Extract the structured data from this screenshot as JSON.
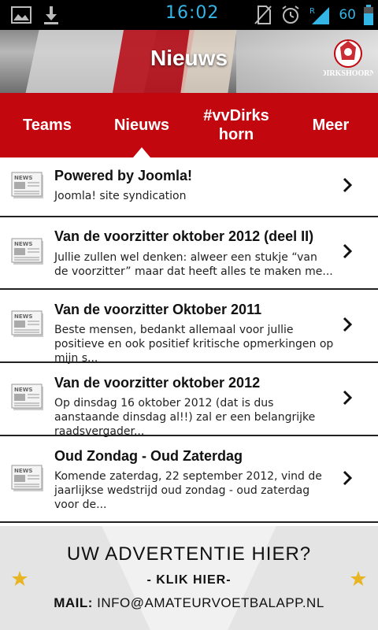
{
  "status_bar": {
    "time": "16:02",
    "battery_percent": "60",
    "icons": [
      "image-icon",
      "download-icon",
      "no-sim-icon",
      "alarm-icon",
      "signal-icon",
      "battery-icon"
    ],
    "signal_label": "R",
    "accent_color": "#33b5e5"
  },
  "header": {
    "title": "Nieuws",
    "logo_text": "DIRKSHOORN"
  },
  "tabs": [
    {
      "label": "Teams",
      "active": false
    },
    {
      "label": "Nieuws",
      "active": true
    },
    {
      "label": "#vvDirks horn",
      "active": false
    },
    {
      "label": "Meer",
      "active": false
    }
  ],
  "theme": {
    "tab_bar_color": "#c2070f"
  },
  "news": [
    {
      "title": "Powered by Joomla!",
      "desc": "Joomla! site syndication",
      "icon": "newspaper-icon"
    },
    {
      "title": "Van de voorzitter oktober 2012 (deel II)",
      "desc": "Jullie zullen wel denken: alweer een stukje “van de voorzitter” maar dat heeft alles te maken me...",
      "icon": "newspaper-icon"
    },
    {
      "title": "Van de voorzitter Oktober 2011",
      "desc": "Beste mensen, bedankt allemaal voor jullie positieve en ook positief kritische opmerkingen op mijn s...",
      "icon": "newspaper-icon"
    },
    {
      "title": "Van de voorzitter oktober 2012",
      "desc": "Op dinsdag 16 oktober 2012 (dat is dus aanstaande dinsdag al!!) zal er een belangrijke raadsvergader...",
      "icon": "newspaper-icon"
    },
    {
      "title": "Oud Zondag - Oud Zaterdag",
      "desc": "Komende zaterdag, 22 september 2012, vind de jaarlijkse wedstrijd oud zondag - oud zaterdag voor de...",
      "icon": "newspaper-icon"
    }
  ],
  "ad": {
    "headline": "UW ADVERTENTIE HIER?",
    "click": "- KLIK HIER-",
    "mail_label": "MAIL:",
    "mail_address": "INFO@AMATEURVOETBALAPP.NL"
  }
}
